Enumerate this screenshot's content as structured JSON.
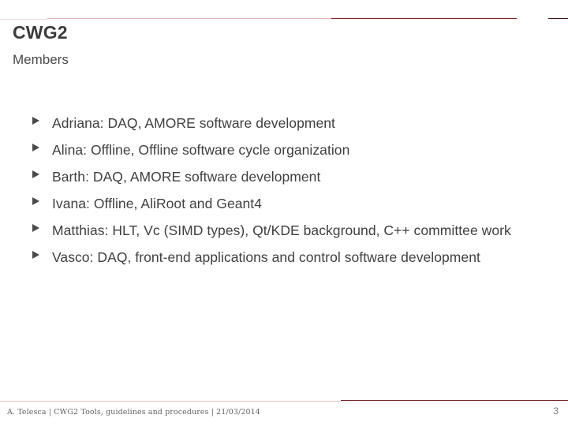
{
  "slide": {
    "title": "CWG2",
    "subtitle": "Members",
    "bullet_glyph": "triangle-right",
    "bullets": [
      "Adriana: DAQ, AMORE software development",
      "Alina: Offline, Offline software cycle organization",
      "Barth: DAQ, AMORE software development",
      "Ivana: Offline, AliRoot and Geant4",
      "Matthias: HLT, Vc (SIMD types), Qt/KDE background, C++ committee work",
      "Vasco: DAQ, front-end applications and control software development"
    ]
  },
  "footer": {
    "text": "A. Telesca | CWG2 Tools, guidelines and procedures | 21/03/2014",
    "page_number": "3"
  },
  "colors": {
    "accent_dark": "#7a2020",
    "accent_light": "#e3b3b3",
    "title_text": "#3b3b3b",
    "body_text": "#3f3f3f",
    "footer_text": "#636363"
  }
}
